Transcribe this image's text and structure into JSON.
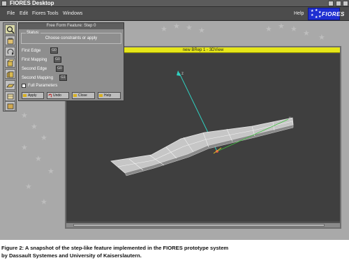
{
  "window": {
    "title": "FIORES Desktop"
  },
  "menubar": {
    "items": [
      "File",
      "Edit",
      "Fiores Tools",
      "Windows"
    ],
    "help": "Help",
    "logo_text": "FIORES"
  },
  "dialog": {
    "title": "Free Form Feature: Step 0",
    "status_label": "Status:",
    "status_message": "Choose constraints or apply",
    "fields": [
      {
        "label": "First Edge",
        "value": "G0"
      },
      {
        "label": "First Mapping",
        "value": "G0"
      },
      {
        "label": "Second Edge",
        "value": "G0"
      },
      {
        "label": "Second Mapping",
        "value": "G1"
      }
    ],
    "full_parameters": "Full Parameters",
    "buttons": {
      "apply": "Apply",
      "undo": "Undo",
      "close": "Close",
      "help": "Help"
    }
  },
  "view": {
    "title": "new BRep 1 - 3DView",
    "axis_labels": {
      "z": "z",
      "y": "y"
    }
  },
  "caption": {
    "line1": "Figure 2: A snapshot of the step-like feature implemented in the FIORES prototype system",
    "line2": "by Dassault Systemes and University of Kaiserslautern."
  },
  "colors": {
    "desktop": "#a9a9a9",
    "menubar": "#4c4c4c",
    "view_title": "#e6e618",
    "viewport": "#3f3f3f",
    "logo": "#1f2fd2",
    "z_axis": "#30d0c0",
    "y_axis": "#40c040"
  }
}
